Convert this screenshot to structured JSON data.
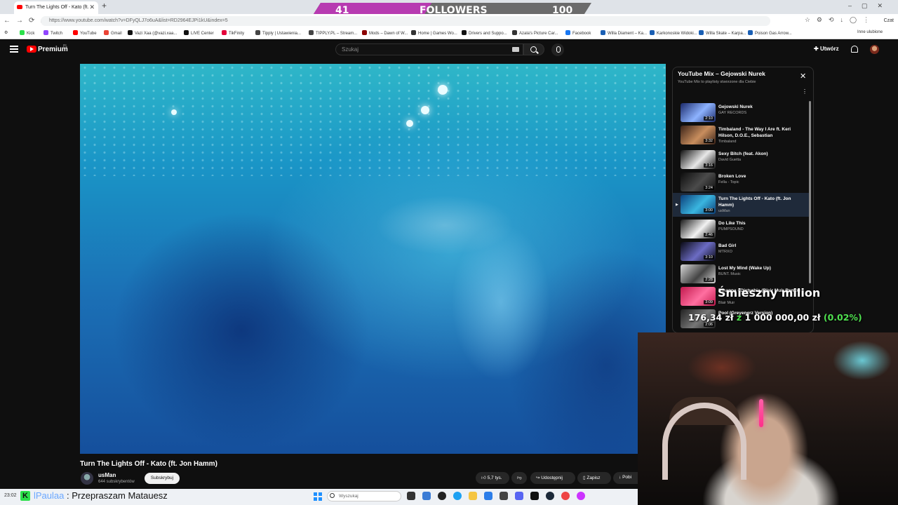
{
  "browser": {
    "tab_title": "Turn The Lights Off - Kato (ft.",
    "url": "https://www.youtube.com/watch?v=DFyQLJ7o6uA&list=RD2964EJPi1kU&index=5",
    "bookmarks": [
      "Kick",
      "Twitch",
      "YouTube",
      "Gmail",
      "Vazi Xaa (@vazi.xaa...",
      "LIVE Center",
      "TikFinity",
      "Tipply | Ustawienia...",
      "TIPPLY.PL – Stream...",
      "Mods – Dawn of W...",
      "Home | Games Wo...",
      "Drivers and Suppo...",
      "Azala's Picture Car...",
      "Facebook",
      "Willa Diament – Ka...",
      "Karkonoskie Widoki...",
      "Willa Skate – Karpa...",
      "Poison Gas Arrow..."
    ],
    "other_bookmarks": "Inne ulubione",
    "profile_label": "Czat"
  },
  "followers_overlay": {
    "current": "41",
    "label": "FOLLOWERS",
    "goal": "100",
    "progress_fraction": 0.41
  },
  "youtube": {
    "brand": "Premium",
    "brand_region": "PL",
    "search_placeholder": "Szukaj",
    "create_label": "Utwórz"
  },
  "video": {
    "title": "Turn The Lights Off - Kato (ft. Jon Hamm)",
    "channel": "usMan",
    "subscribers": "644 subskrybentów",
    "subscribe_label": "Subskrybuj",
    "likes": "5,7 tys.",
    "share_label": "Udostępnij",
    "save_label": "Zapisz",
    "download_label": "Pobi"
  },
  "playlist": {
    "title": "YouTube Mix – Gejowski Nurek",
    "subtitle": "YouTube Mix to playlisty stworzone dla Ciebie",
    "items": [
      {
        "title": "Gejowski Nurek",
        "artist": "GAY RECORDS",
        "duration": "2:10",
        "color1": "#1b2a6b",
        "color2": "#8db3ff"
      },
      {
        "title": "Timbaland - The Way I Are ft. Keri Hilson, D.O.E., Sebastian",
        "artist": "Timbaland",
        "duration": "3:32",
        "color1": "#3a2218",
        "color2": "#c98e5e"
      },
      {
        "title": "Sexy Bitch (feat. Akon)",
        "artist": "David Guetta",
        "duration": "3:16",
        "color1": "#111111",
        "color2": "#e8e8e8"
      },
      {
        "title": "Broken Love",
        "artist": "Fella - Topic",
        "duration": "3:24",
        "color1": "#0d0d0d",
        "color2": "#4b4b4b"
      },
      {
        "title": "Turn The Lights Off - Kato (ft. Jon Hamm)",
        "artist": "usMan",
        "duration": "3:00",
        "color1": "#0c3f7a",
        "color2": "#3ab6e0"
      },
      {
        "title": "Do Like This",
        "artist": "PUMPSOUND",
        "duration": "2:46",
        "color1": "#1a1a1a",
        "color2": "#f2f2f2"
      },
      {
        "title": "Bad Girl",
        "artist": "MTRXO",
        "duration": "3:10",
        "color1": "#0a0a14",
        "color2": "#6c6cc4"
      },
      {
        "title": "Lost My Mind (Wake Up)",
        "artist": "BUNT. Music",
        "duration": "2:28",
        "color1": "#d8d8d8",
        "color2": "#444444"
      },
      {
        "title": "Rihanna - Disturbia (Blair Muir Remix)",
        "artist": "Blair Muir",
        "duration": "3:09",
        "color1": "#c21a4e",
        "color2": "#ff6fa0"
      },
      {
        "title": "Pool (Greyenerz Version)",
        "artist": "",
        "duration": "2:06",
        "color1": "#222222",
        "color2": "#777777"
      }
    ],
    "active_index": 4
  },
  "donation_overlay": {
    "title": "Śmieszny milion",
    "current": "176,34 zł",
    "connector": "z",
    "goal": "1 000 000,00 zł",
    "percent": "(0.02%)"
  },
  "taskbar": {
    "time": "23:02",
    "search_placeholder": "Wyszukaj"
  },
  "chat_message": {
    "username": "lPaulaa",
    "separator": ":",
    "text": "Przepraszam Matauesz"
  }
}
